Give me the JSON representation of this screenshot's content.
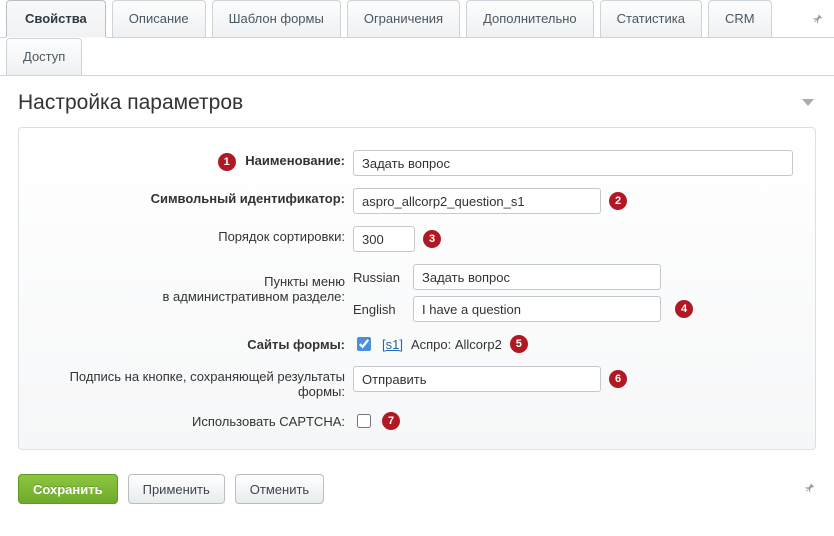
{
  "tabs": {
    "row1": [
      "Свойства",
      "Описание",
      "Шаблон формы",
      "Ограничения",
      "Дополнительно",
      "Статистика",
      "CRM"
    ],
    "row2": [
      "Доступ"
    ],
    "activeIndex": 0
  },
  "section": {
    "title": "Настройка параметров"
  },
  "form": {
    "name_label": "Наименование:",
    "name_value": "Задать вопрос",
    "code_label": "Символьный идентификатор:",
    "code_value": "aspro_allcorp2_question_s1",
    "sort_label": "Порядок сортировки:",
    "sort_value": "300",
    "menu_label_1": "Пункты меню",
    "menu_label_2": "в административном разделе:",
    "lang_ru_label": "Russian",
    "lang_ru_value": "Задать вопрос",
    "lang_en_label": "English",
    "lang_en_value": "I have a question",
    "sites_label": "Сайты формы:",
    "site_code": "[s1]",
    "site_name": " Аспро: Allcorp2",
    "button_caption_label": "Подпись на кнопке, сохраняющей результаты формы:",
    "button_caption_value": "Отправить",
    "captcha_label": "Использовать CAPTCHA:"
  },
  "badges": {
    "b1": "1",
    "b2": "2",
    "b3": "3",
    "b4": "4",
    "b5": "5",
    "b6": "6",
    "b7": "7"
  },
  "footer": {
    "save": "Сохранить",
    "apply": "Применить",
    "cancel": "Отменить"
  }
}
